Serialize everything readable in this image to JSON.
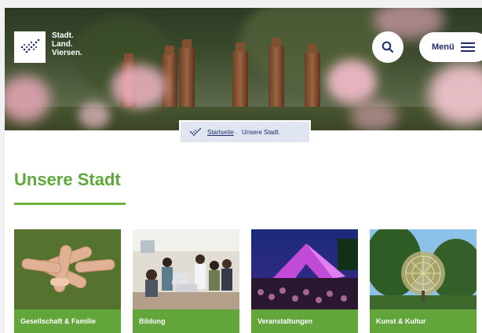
{
  "header": {
    "logo": {
      "lines": [
        "Stadt.",
        "Land.",
        "Viersen."
      ],
      "icon": "viersen-logo-icon"
    },
    "search_icon": "search-icon",
    "menu_label": "Menü",
    "menu_icon": "hamburger-icon"
  },
  "breadcrumb": {
    "home_icon": "check-icon",
    "items": [
      "Startseite",
      "Unsere Stadt."
    ]
  },
  "main": {
    "title": "Unsere Stadt",
    "cards": [
      {
        "label": "Gesellschaft & Familie"
      },
      {
        "label": "Bildung"
      },
      {
        "label": "Veranstaltungen"
      },
      {
        "label": "Kunst & Kultur"
      }
    ]
  },
  "colors": {
    "brand_green": "#62a53a",
    "navy": "#1f2d6e",
    "breadcrumb_bg": "#dfe6f1"
  }
}
